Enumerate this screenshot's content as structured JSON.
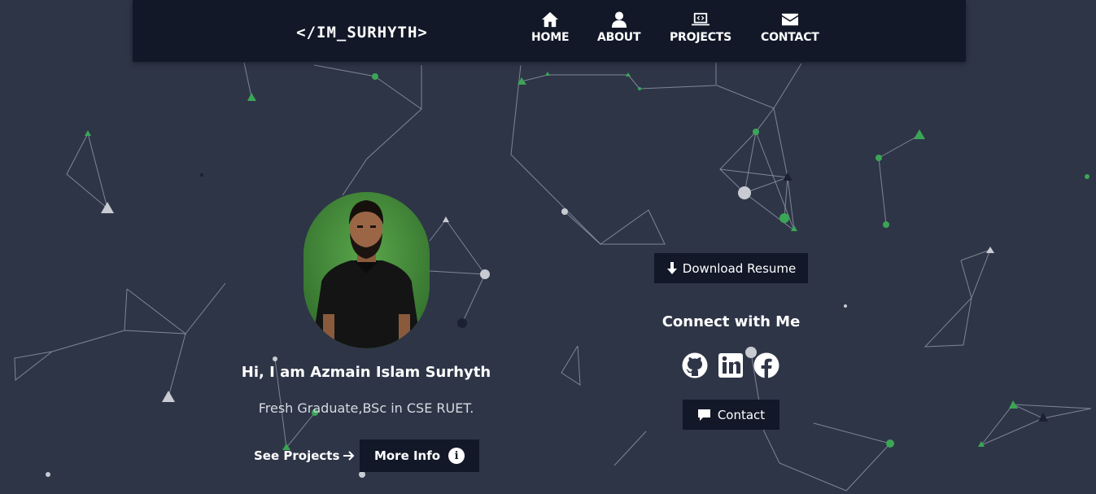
{
  "nav": {
    "brand": "</IM_SURHYTH>",
    "items": [
      {
        "label": "HOME",
        "icon": "home-icon"
      },
      {
        "label": "ABOUT",
        "icon": "user-icon"
      },
      {
        "label": "PROJECTS",
        "icon": "laptop-code-icon"
      },
      {
        "label": "CONTACT",
        "icon": "envelope-icon"
      }
    ]
  },
  "profile": {
    "greeting": "Hi, I am Azmain Islam Surhyth",
    "subtitle": "Fresh Graduate,BSc in CSE RUET.",
    "see_projects_label": "See Projects",
    "more_info_label": "More Info"
  },
  "actions": {
    "download_label": "Download Resume",
    "connect_title": "Connect with Me",
    "socials": [
      "github-icon",
      "linkedin-icon",
      "facebook-icon"
    ],
    "contact_label": "Contact"
  },
  "colors": {
    "background": "#2e3547",
    "navbar": "#121828",
    "button": "#121828",
    "particle_green": "#3aa655",
    "particle_light": "#c8cbd2"
  }
}
